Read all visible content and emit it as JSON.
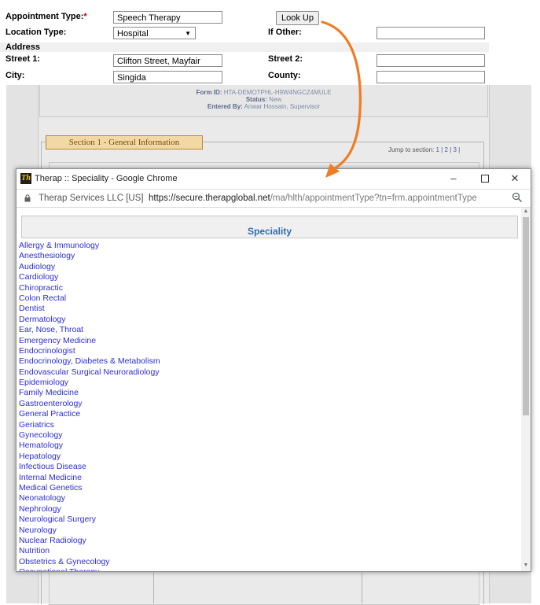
{
  "form": {
    "appointment_type_label": "Appointment Type:",
    "required_mark": "*",
    "appointment_type_value": "Speech Therapy",
    "look_up_label": "Look Up",
    "location_type_label": "Location Type:",
    "location_type_value": "Hospital",
    "if_other_label": "If Other:",
    "if_other_value": "",
    "address_header": "Address",
    "street1_label": "Street 1:",
    "street1_value": "Clifton Street, Mayfair",
    "street2_label": "Street 2:",
    "street2_value": "",
    "city_label": "City:",
    "city_value": "Singida",
    "county_label": "County:",
    "county_value": ""
  },
  "background_page": {
    "form_id_label": "Form ID:",
    "form_id_value": "HTA-DEMOTPHL-H9W4NGCZ4MULE",
    "status_label": "Status:",
    "status_value": "New",
    "entered_by_label": "Entered By:",
    "entered_by_value": "Anwar Hossain, Supervisor",
    "section_title": "Section 1 - General Information",
    "jump_label": "Jump to section:",
    "jump_links": [
      "1",
      "2",
      "3"
    ]
  },
  "popup": {
    "window_title": "Therap :: Speciality - Google Chrome",
    "site_name": "Therap Services LLC [US]",
    "url_host": "https://secure.therapglobal.net",
    "url_path": "/ma/hlth/appointmentType?tn=frm.appointmentType",
    "header": "Speciality",
    "specialities": [
      "Allergy & Immunology",
      "Anesthesiology",
      "Audiology",
      "Cardiology",
      "Chiropractic",
      "Colon Rectal",
      "Dentist",
      "Dermatology",
      "Ear, Nose, Throat",
      "Emergency Medicine",
      "Endocrinologist",
      "Endocrinology, Diabetes & Metabolism",
      "Endovascular Surgical Neuroradiology",
      "Epidemiology",
      "Family Medicine",
      "Gastroenterology",
      "General Practice",
      "Geriatrics",
      "Gynecology",
      "Hematology",
      "Hepatology",
      "Infectious Disease",
      "Internal Medicine",
      "Medical Genetics",
      "Neonatology",
      "Nephrology",
      "Neurological Surgery",
      "Neurology",
      "Nuclear Radiology",
      "Nutrition",
      "Obstetrics & Gynecology",
      "Occupational Therapy"
    ]
  },
  "colors": {
    "annotation_arrow": "#f07c22",
    "link": "#2c2cd8",
    "header_text": "#2f6bb0"
  },
  "icons": {
    "logo": "therap-logo-icon",
    "minimize": "minimize-icon",
    "maximize": "maximize-icon",
    "close": "close-icon",
    "lock": "lock-icon",
    "zoom": "zoom-icon"
  }
}
